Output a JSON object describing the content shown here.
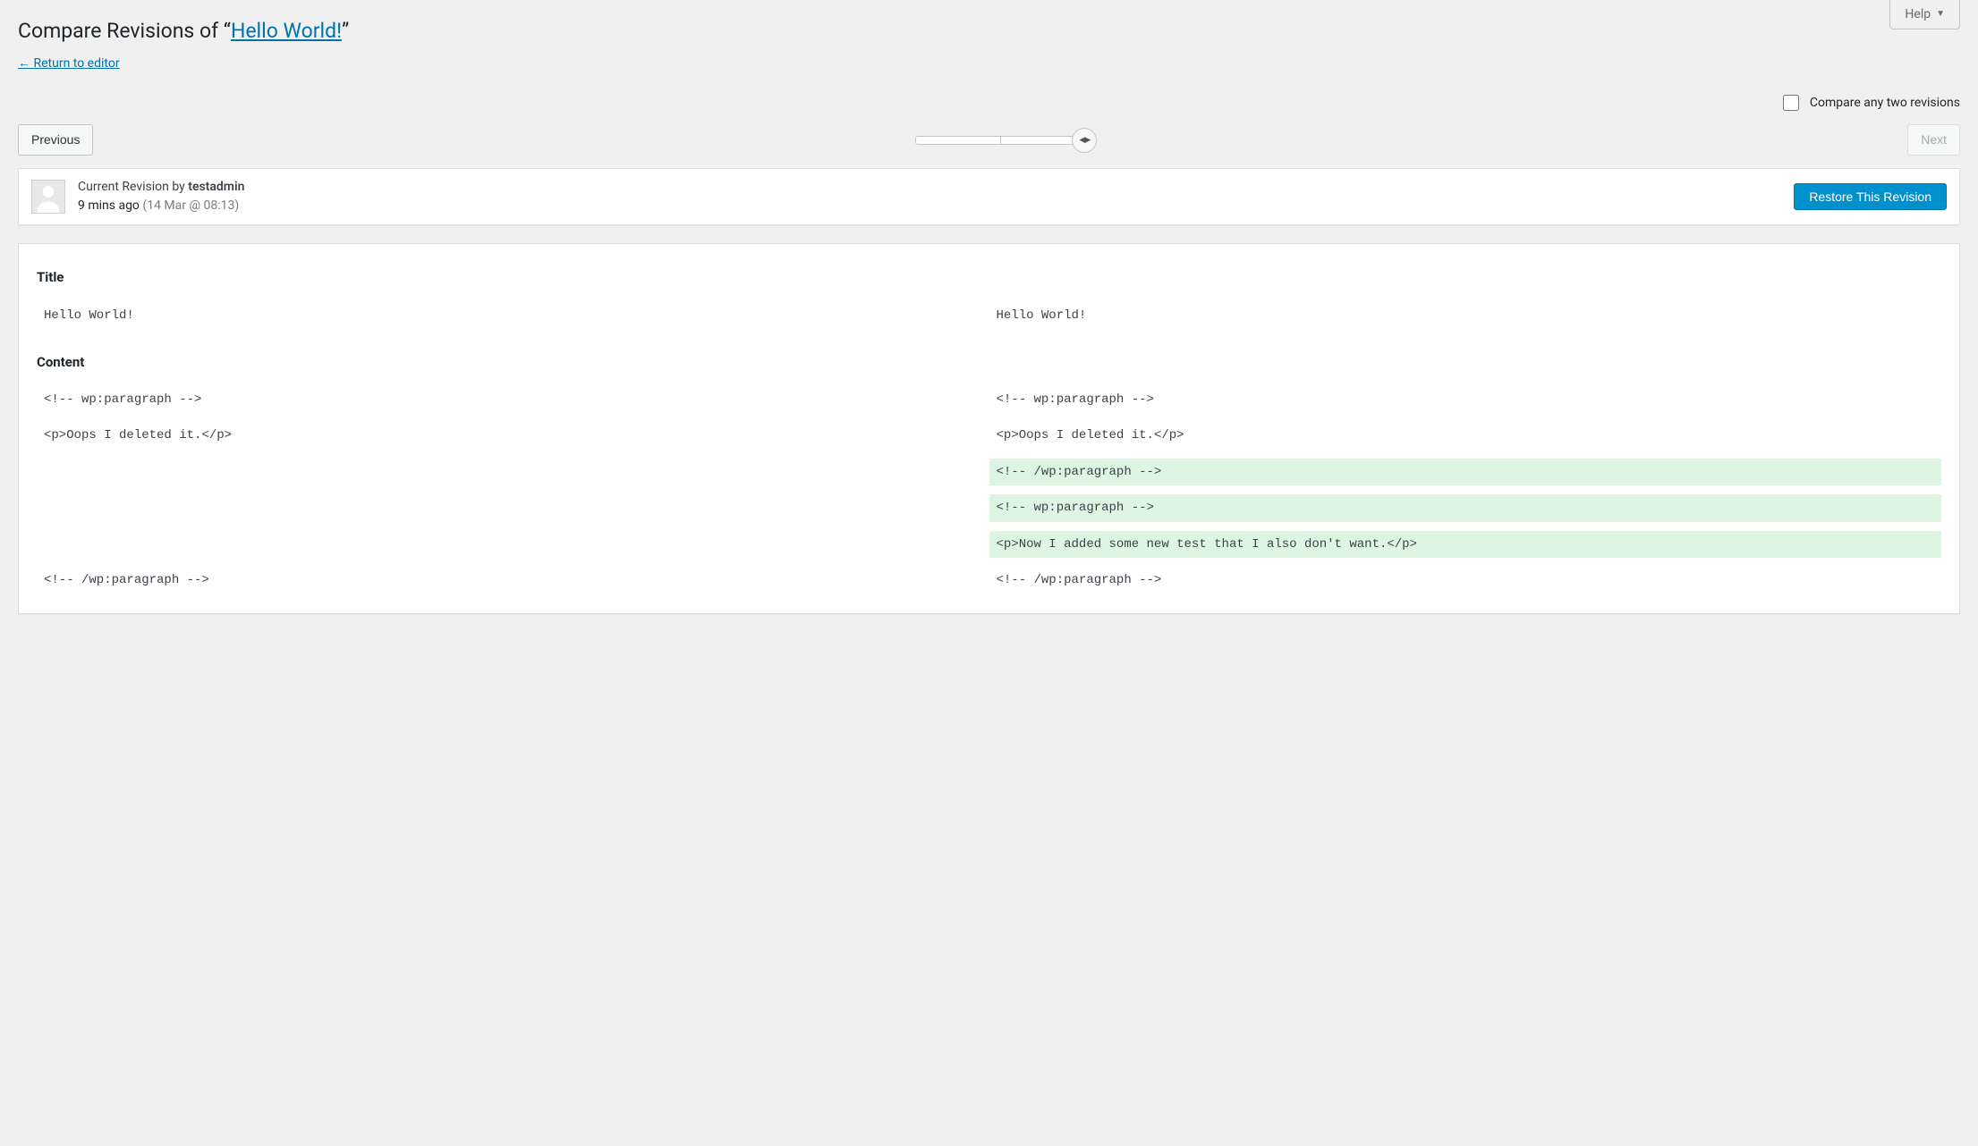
{
  "help": {
    "label": "Help"
  },
  "page_title": {
    "prefix": "Compare Revisions of “",
    "link_text": "Hello World!",
    "suffix": "”"
  },
  "return_link": "← Return to editor",
  "compare_any": {
    "label": "Compare any two revisions",
    "checked": false
  },
  "nav": {
    "previous": "Previous",
    "next": "Next",
    "next_disabled": true
  },
  "meta": {
    "line1_prefix": "Current Revision by ",
    "author": "testadmin",
    "ago": "9 mins ago",
    "timestamp": "(14 Mar @ 08:13)"
  },
  "restore_button": "Restore This Revision",
  "sections": {
    "title_heading": "Title",
    "content_heading": "Content"
  },
  "diff": {
    "title": {
      "left": "Hello World!",
      "right": "Hello World!"
    },
    "content_rows": [
      {
        "left": "<!-- wp:paragraph -->",
        "right": "<!-- wp:paragraph -->",
        "type": "ctx"
      },
      {
        "type": "spacer"
      },
      {
        "left": "<p>Oops I deleted it.</p>",
        "right": "<p>Oops I deleted it.</p>",
        "type": "ctx"
      },
      {
        "type": "spacer"
      },
      {
        "left": "",
        "right": "<!-- /wp:paragraph -->",
        "type": "added"
      },
      {
        "type": "spacer"
      },
      {
        "left": "",
        "right": "<!-- wp:paragraph -->",
        "type": "added"
      },
      {
        "type": "spacer"
      },
      {
        "left": "",
        "right": "<p>Now I added some new test that I also don't want.</p>",
        "type": "added"
      },
      {
        "type": "spacer"
      },
      {
        "left": "<!-- /wp:paragraph -->",
        "right": "<!-- /wp:paragraph -->",
        "type": "ctx"
      }
    ]
  }
}
